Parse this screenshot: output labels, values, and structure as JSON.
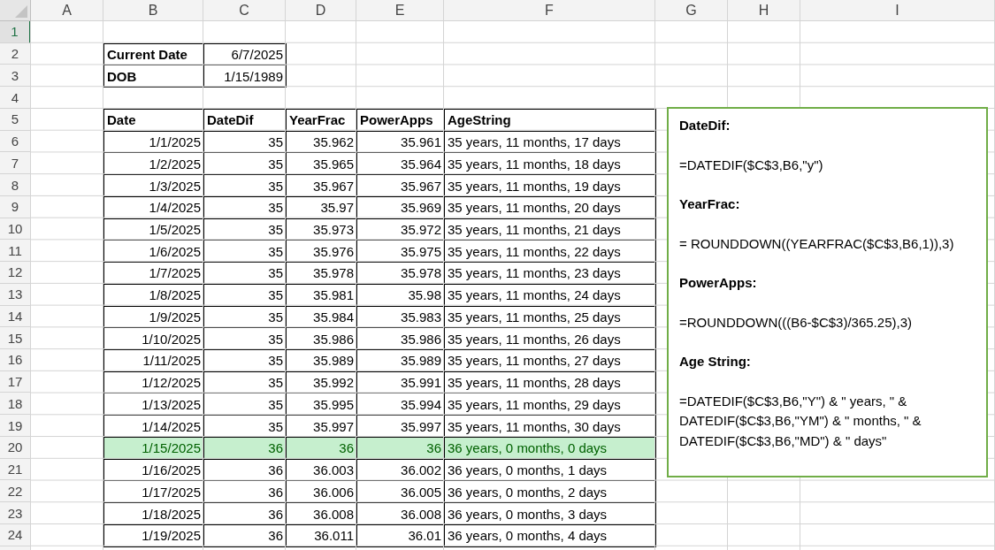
{
  "column_headers": [
    "A",
    "B",
    "C",
    "D",
    "E",
    "F",
    "G",
    "H",
    "I"
  ],
  "row_headers": [
    {
      "label": "1",
      "selected": true
    },
    {
      "label": "2",
      "selected": false
    },
    {
      "label": "3",
      "selected": false
    },
    {
      "label": "4",
      "selected": false
    },
    {
      "label": "5",
      "selected": false
    },
    {
      "label": "6",
      "selected": false
    },
    {
      "label": "7",
      "selected": false
    },
    {
      "label": "8",
      "selected": false
    },
    {
      "label": "9",
      "selected": false
    },
    {
      "label": "10",
      "selected": false
    },
    {
      "label": "11",
      "selected": false
    },
    {
      "label": "12",
      "selected": false
    },
    {
      "label": "13",
      "selected": false
    },
    {
      "label": "14",
      "selected": false
    },
    {
      "label": "15",
      "selected": false
    },
    {
      "label": "16",
      "selected": false
    },
    {
      "label": "17",
      "selected": false
    },
    {
      "label": "18",
      "selected": false
    },
    {
      "label": "19",
      "selected": false
    },
    {
      "label": "20",
      "selected": false
    },
    {
      "label": "21",
      "selected": false
    },
    {
      "label": "22",
      "selected": false
    },
    {
      "label": "23",
      "selected": false
    },
    {
      "label": "24",
      "selected": false
    }
  ],
  "info_table": [
    {
      "label": "Current Date",
      "value": "6/7/2025"
    },
    {
      "label": "DOB",
      "value": "1/15/1989"
    }
  ],
  "data_table": {
    "columns": [
      "Date",
      "DateDif",
      "YearFrac",
      "PowerApps",
      "AgeString"
    ],
    "rows": [
      {
        "cells": [
          "1/1/2025",
          "35",
          "35.962",
          "35.961",
          "35 years, 11 months, 17 days"
        ],
        "highlighted": false
      },
      {
        "cells": [
          "1/2/2025",
          "35",
          "35.965",
          "35.964",
          "35 years, 11 months, 18 days"
        ],
        "highlighted": false
      },
      {
        "cells": [
          "1/3/2025",
          "35",
          "35.967",
          "35.967",
          "35 years, 11 months, 19 days"
        ],
        "highlighted": false
      },
      {
        "cells": [
          "1/4/2025",
          "35",
          "35.97",
          "35.969",
          "35 years, 11 months, 20 days"
        ],
        "highlighted": false
      },
      {
        "cells": [
          "1/5/2025",
          "35",
          "35.973",
          "35.972",
          "35 years, 11 months, 21 days"
        ],
        "highlighted": false
      },
      {
        "cells": [
          "1/6/2025",
          "35",
          "35.976",
          "35.975",
          "35 years, 11 months, 22 days"
        ],
        "highlighted": false
      },
      {
        "cells": [
          "1/7/2025",
          "35",
          "35.978",
          "35.978",
          "35 years, 11 months, 23 days"
        ],
        "highlighted": false
      },
      {
        "cells": [
          "1/8/2025",
          "35",
          "35.981",
          "35.98",
          "35 years, 11 months, 24 days"
        ],
        "highlighted": false
      },
      {
        "cells": [
          "1/9/2025",
          "35",
          "35.984",
          "35.983",
          "35 years, 11 months, 25 days"
        ],
        "highlighted": false
      },
      {
        "cells": [
          "1/10/2025",
          "35",
          "35.986",
          "35.986",
          "35 years, 11 months, 26 days"
        ],
        "highlighted": false
      },
      {
        "cells": [
          "1/11/2025",
          "35",
          "35.989",
          "35.989",
          "35 years, 11 months, 27 days"
        ],
        "highlighted": false
      },
      {
        "cells": [
          "1/12/2025",
          "35",
          "35.992",
          "35.991",
          "35 years, 11 months, 28 days"
        ],
        "highlighted": false
      },
      {
        "cells": [
          "1/13/2025",
          "35",
          "35.995",
          "35.994",
          "35 years, 11 months, 29 days"
        ],
        "highlighted": false
      },
      {
        "cells": [
          "1/14/2025",
          "35",
          "35.997",
          "35.997",
          "35 years, 11 months, 30 days"
        ],
        "highlighted": false
      },
      {
        "cells": [
          "1/15/2025",
          "36",
          "36",
          "36",
          "36 years, 0 months, 0 days"
        ],
        "highlighted": true
      },
      {
        "cells": [
          "1/16/2025",
          "36",
          "36.003",
          "36.002",
          "36 years, 0 months, 1 days"
        ],
        "highlighted": false
      },
      {
        "cells": [
          "1/17/2025",
          "36",
          "36.006",
          "36.005",
          "36 years, 0 months, 2 days"
        ],
        "highlighted": false
      },
      {
        "cells": [
          "1/18/2025",
          "36",
          "36.008",
          "36.008",
          "36 years, 0 months, 3 days"
        ],
        "highlighted": false
      },
      {
        "cells": [
          "1/19/2025",
          "36",
          "36.011",
          "36.01",
          "36 years, 0 months, 4 days"
        ],
        "highlighted": false
      }
    ]
  },
  "text_box": {
    "paragraphs": [
      {
        "kind": "heading",
        "text": "DateDif:"
      },
      {
        "kind": "formula",
        "text": "=DATEDIF($C$3,B6,\"y\")"
      },
      {
        "kind": "heading",
        "text": "YearFrac:"
      },
      {
        "kind": "formula",
        "text": "= ROUNDDOWN((YEARFRAC($C$3,B6,1)),3)"
      },
      {
        "kind": "heading",
        "text": "PowerApps:"
      },
      {
        "kind": "formula",
        "text": "=ROUNDDOWN(((B6-$C$3)/365.25),3)"
      },
      {
        "kind": "heading",
        "text": "Age String:"
      },
      {
        "kind": "formula",
        "text": "=DATEDIF($C$3,B6,\"Y\") & \" years, \" & DATEDIF($C$3,B6,\"YM\") & \" months, \" & DATEDIF($C$3,B6,\"MD\") & \" days\""
      }
    ]
  }
}
